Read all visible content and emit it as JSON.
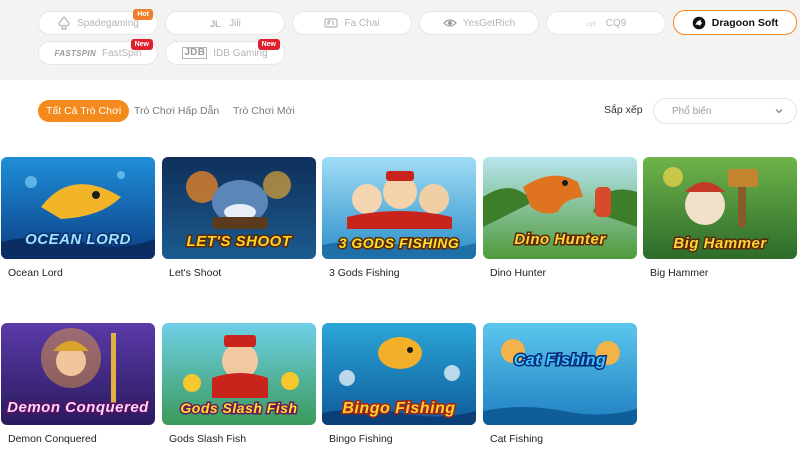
{
  "providers": [
    {
      "label": "Spadegaming",
      "icon": "spade-icon",
      "badge": "Hot",
      "active": false
    },
    {
      "label": "Jili",
      "icon": "jili-logo-icon",
      "badge": "",
      "active": false
    },
    {
      "label": "Fa Chai",
      "icon": "fachai-logo-icon",
      "badge": "",
      "active": false
    },
    {
      "label": "YesGetRich",
      "icon": "eye-logo-icon",
      "badge": "",
      "active": false
    },
    {
      "label": "CQ9",
      "icon": "cq9-logo-icon",
      "badge": "",
      "active": false
    },
    {
      "label": "Dragoon Soft",
      "icon": "dragon-logo-icon",
      "badge": "",
      "active": true
    },
    {
      "label": "FastSpin",
      "icon": "fastspin-logo-icon",
      "brand": "FASTSPIN",
      "badge": "New",
      "active": false
    },
    {
      "label": "IDB Gaming",
      "icon": "jdb-logo-icon",
      "brand": "JDB",
      "badge": "New",
      "active": false
    }
  ],
  "filters": {
    "tabs": [
      "Tất Cả Trò Chơi",
      "Trò Chơi Hấp Dẫn",
      "Trò Chơi Mới"
    ],
    "active_tab": "Tất Cả Trò Chơi",
    "sort_label": "Sắp xếp",
    "sort_value": "Phổ biến"
  },
  "games": [
    {
      "name": "Ocean Lord",
      "art_title": "OCEAN LORD"
    },
    {
      "name": "Let's Shoot",
      "art_title": "LET'S SHOOT"
    },
    {
      "name": "3 Gods Fishing",
      "art_title": "3 GODS FISHING"
    },
    {
      "name": "Dino Hunter",
      "art_title": "Dino Hunter"
    },
    {
      "name": "Big Hammer",
      "art_title": "Big Hammer"
    },
    {
      "name": "Demon Conquered",
      "art_title": "Demon Conquered"
    },
    {
      "name": "Gods Slash Fish",
      "art_title": "Gods Slash Fish"
    },
    {
      "name": "Bingo Fishing",
      "art_title": "Bingo Fishing"
    },
    {
      "name": "Cat Fishing",
      "art_title": "Cat Fishing"
    }
  ],
  "colors": {
    "accent": "#f48a1c",
    "badge_hot": "#f07d2c",
    "badge_new": "#e0202d"
  }
}
